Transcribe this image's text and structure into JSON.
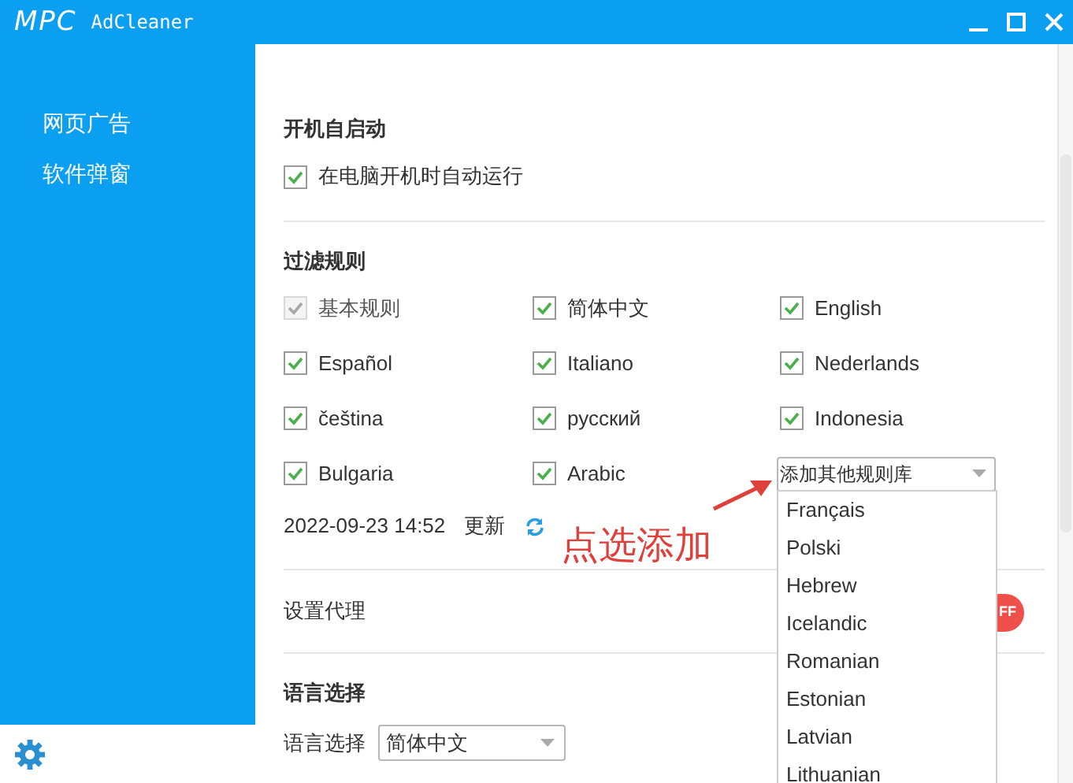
{
  "window": {
    "logo": "MPC",
    "title": "AdCleaner"
  },
  "sidebar": {
    "items": [
      {
        "label": "网页广告"
      },
      {
        "label": "软件弹窗"
      }
    ]
  },
  "startup": {
    "heading": "开机自启动",
    "option": {
      "label": "在电脑开机时自动运行",
      "checked": true
    }
  },
  "filter_rules": {
    "heading": "过滤规则",
    "rules": [
      {
        "label": "基本规则",
        "checked": true,
        "disabled": true
      },
      {
        "label": "简体中文",
        "checked": true,
        "disabled": false
      },
      {
        "label": "English",
        "checked": true,
        "disabled": false
      },
      {
        "label": "Español",
        "checked": true,
        "disabled": false
      },
      {
        "label": "Italiano",
        "checked": true,
        "disabled": false
      },
      {
        "label": "Nederlands",
        "checked": true,
        "disabled": false
      },
      {
        "label": "čeština",
        "checked": true,
        "disabled": false
      },
      {
        "label": "русский",
        "checked": true,
        "disabled": false
      },
      {
        "label": "Indonesia",
        "checked": true,
        "disabled": false
      },
      {
        "label": "Bulgaria",
        "checked": true,
        "disabled": false
      },
      {
        "label": "Arabic",
        "checked": true,
        "disabled": false
      }
    ],
    "add_select": {
      "value": "添加其他规则库",
      "expanded": true,
      "options": [
        "Français",
        "Polski",
        "Hebrew",
        "Icelandic",
        "Romanian",
        "Estonian",
        "Latvian",
        "Lithuanian"
      ]
    },
    "updated": "2022-09-23 14:52",
    "update_link": "更新"
  },
  "proxy": {
    "label": "设置代理",
    "toggle": {
      "on": false,
      "text": "FF"
    }
  },
  "language": {
    "heading": "语言选择",
    "label": "语言选择",
    "select": {
      "value": "简体中文"
    }
  },
  "annotation": {
    "text": "点选添加"
  }
}
